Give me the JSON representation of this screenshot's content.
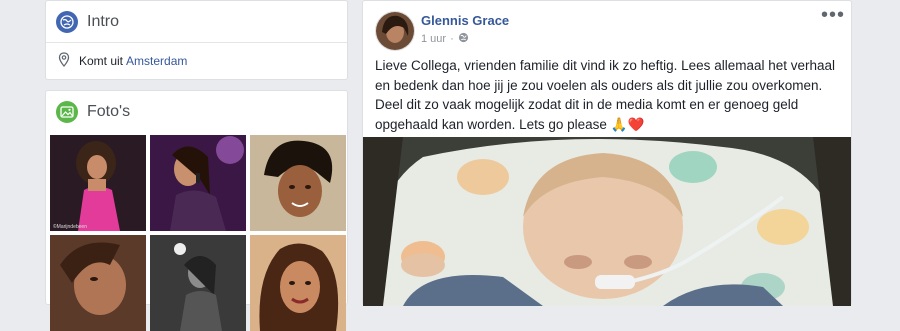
{
  "intro": {
    "title": "Intro",
    "location_prefix": "Komt uit",
    "location_link": "Amsterdam",
    "icons": {
      "header": "globe-icon",
      "location": "location-pin-icon"
    }
  },
  "photos": {
    "title": "Foto's",
    "header_icon": "photo-icon",
    "watermark": "©Marijndebeen"
  },
  "post": {
    "author": "Glennis Grace",
    "time": "1 uur",
    "separator": "·",
    "audience_icon": "globe-icon",
    "more_label": "•••",
    "text_line1": "Lieve Collega, vrienden familie dit vind ik zo heftig. Lees allemaal het verhaal",
    "text_line2": "en bedenk dan hoe jij je zou voelen als ouders als dit jullie zou overkomen.",
    "text_line3": "Deel dit zo vaak mogelijk zodat dit in de media komt en er genoeg geld",
    "text_line4": "opgehaald kan worden. Lets go please",
    "emoji": "🙏❤️"
  },
  "colors": {
    "brand_blue": "#4267b2",
    "link": "#365899",
    "background": "#e9ebee",
    "photos_green": "#5bb749"
  }
}
